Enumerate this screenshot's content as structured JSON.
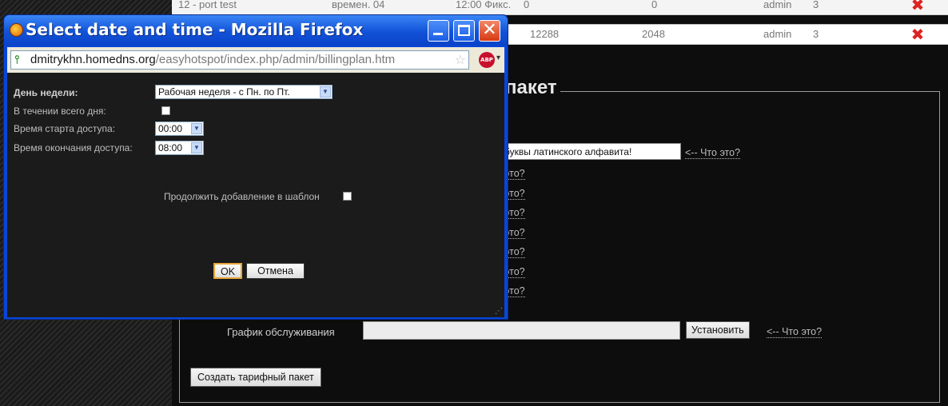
{
  "table": {
    "row1": {
      "name": "12 - port test",
      "type": "времен. 04",
      "date": "12:00 Фикс.",
      "col4": "0",
      "col5": "0",
      "user": "admin",
      "count": "3"
    },
    "row2": {
      "col4": "12288",
      "col5": "2048",
      "user": "admin",
      "count": "3"
    }
  },
  "form": {
    "legend": "пакет",
    "name_value": "буквы латинского алфавита!",
    "help_link": "<-- Что это?",
    "partial_help": "это?",
    "schedule_label": "График обслуживания",
    "schedule_value": "",
    "set_button": "Установить",
    "create_button": "Создать тарифный пакет"
  },
  "popup": {
    "title": "Select date and time - Mozilla Firefox",
    "url_domain": "dmitrykhn.homedns.org",
    "url_rest": "/easyhotspot/index.php/admin/billingplan.htm",
    "abp_label": "ABP",
    "day_label": "День недели:",
    "day_value": "Рабочая неделя - с Пн. по Пт.",
    "all_day_label": "В течении всего дня:",
    "start_label": "Время старта доступа:",
    "start_value": "00:00",
    "end_label": "Время окончания доступа:",
    "end_value": "08:00",
    "continue_label": "Продолжить добавление в шаблон",
    "ok": "OK",
    "cancel": "Отмена"
  }
}
